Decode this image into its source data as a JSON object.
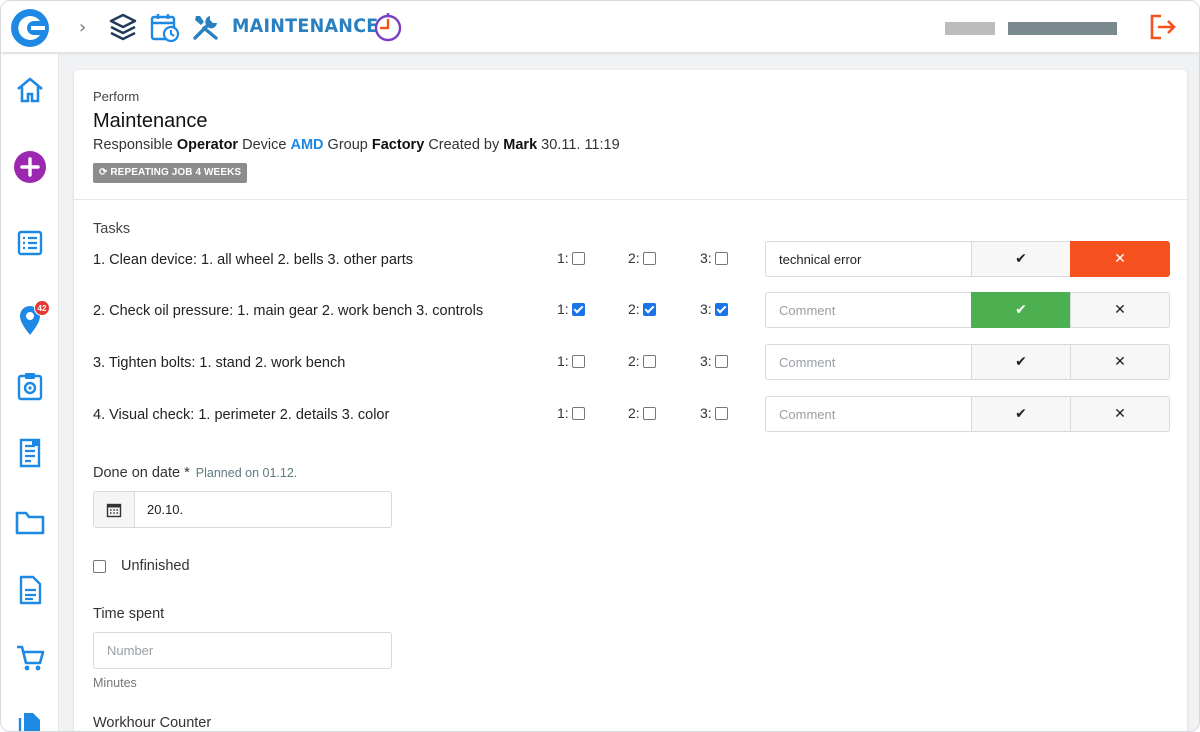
{
  "header": {
    "app_title": "MAINTENANCE",
    "breadcrumb_chevron": "›",
    "colors": {
      "brand": "#1e88e5",
      "title": "#2a7fc0",
      "logout": "#f4511e",
      "timer": "#7b3fc4"
    }
  },
  "sidebar": {
    "items": [
      {
        "name": "home-icon"
      },
      {
        "name": "add-circle-icon"
      },
      {
        "name": "list-icon"
      },
      {
        "name": "location-pin-icon",
        "badge": "42"
      },
      {
        "name": "settings-clipboard-icon"
      },
      {
        "name": "receipt-icon"
      },
      {
        "name": "folder-icon"
      },
      {
        "name": "document-icon"
      },
      {
        "name": "cart-icon"
      },
      {
        "name": "files-icon"
      }
    ]
  },
  "job": {
    "perform_label": "Perform",
    "title": "Maintenance",
    "responsible_label": "Responsible",
    "responsible": "Operator",
    "device_label": "Device",
    "device": "AMD",
    "group_label": "Group",
    "group": "Factory",
    "created_label": "Created by",
    "created_by": "Mark",
    "created_at": "30.11. 11:19",
    "repeat_tag": "⟳ REPEATING JOB 4 WEEKS"
  },
  "tasks": {
    "label": "Tasks",
    "items": [
      {
        "text": "1. Clean device: 1. all wheel 2. bells 3. other parts",
        "checks": [
          false,
          false,
          false
        ],
        "comment": "technical error",
        "comment_placeholder": "",
        "ok": "✔",
        "no": "✕",
        "state": "failed"
      },
      {
        "text": "2. Check oil pressure: 1. main gear 2. work bench 3. controls",
        "checks": [
          true,
          true,
          true
        ],
        "comment": "",
        "comment_placeholder": "Comment",
        "ok": "✔",
        "no": "✕",
        "state": "done"
      },
      {
        "text": "3. Tighten bolts: 1. stand 2. work bench",
        "checks": [
          false,
          false,
          false
        ],
        "comment": "",
        "comment_placeholder": "Comment",
        "ok": "✔",
        "no": "✕",
        "state": "none"
      },
      {
        "text": "4. Visual check: 1. perimeter 2. details 3. color",
        "checks": [
          false,
          false,
          false
        ],
        "comment": "",
        "comment_placeholder": "Comment",
        "ok": "✔",
        "no": "✕",
        "state": "none"
      }
    ],
    "check_labels": [
      "1:",
      "2:",
      "3:"
    ]
  },
  "form": {
    "done_label": "Done on date *",
    "planned": "Planned on 01.12.",
    "done_value": "20.10.",
    "unfinished_label": "Unfinished",
    "time_label": "Time spent",
    "time_placeholder": "Number",
    "time_unit": "Minutes",
    "workhour_label": "Workhour Counter"
  }
}
